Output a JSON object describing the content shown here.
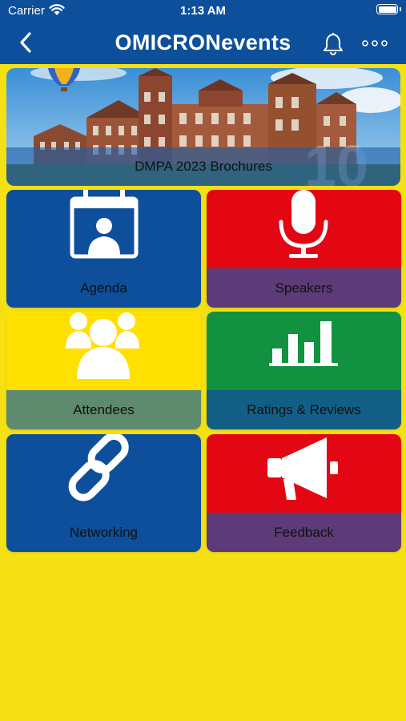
{
  "status_bar": {
    "carrier": "Carrier",
    "time": "1:13 AM"
  },
  "nav": {
    "title": "OMICRONevents"
  },
  "banner": {
    "label": "DMPA 2023 Brochures"
  },
  "tiles": [
    {
      "label": "Agenda",
      "icon": "calendar-person-icon",
      "icon_bg": "#0d4f9a",
      "label_bg": "#0d4f9a"
    },
    {
      "label": "Speakers",
      "icon": "microphone-icon",
      "icon_bg": "#e30613",
      "label_bg": "#5c3b78"
    },
    {
      "label": "Attendees",
      "icon": "people-group-icon",
      "icon_bg": "#ffe000",
      "label_bg": "#5e8a6d"
    },
    {
      "label": "Ratings & Reviews",
      "icon": "bar-chart-icon",
      "icon_bg": "#129240",
      "label_bg": "#135e84"
    },
    {
      "label": "Networking",
      "icon": "chain-link-icon",
      "icon_bg": "#0d4f9a",
      "label_bg": "#0d4f9a"
    },
    {
      "label": "Feedback",
      "icon": "megaphone-icon",
      "icon_bg": "#e30613",
      "label_bg": "#5c3b78"
    }
  ],
  "colors": {
    "header": "#0d4f9a",
    "page_background": "#f5e014"
  }
}
